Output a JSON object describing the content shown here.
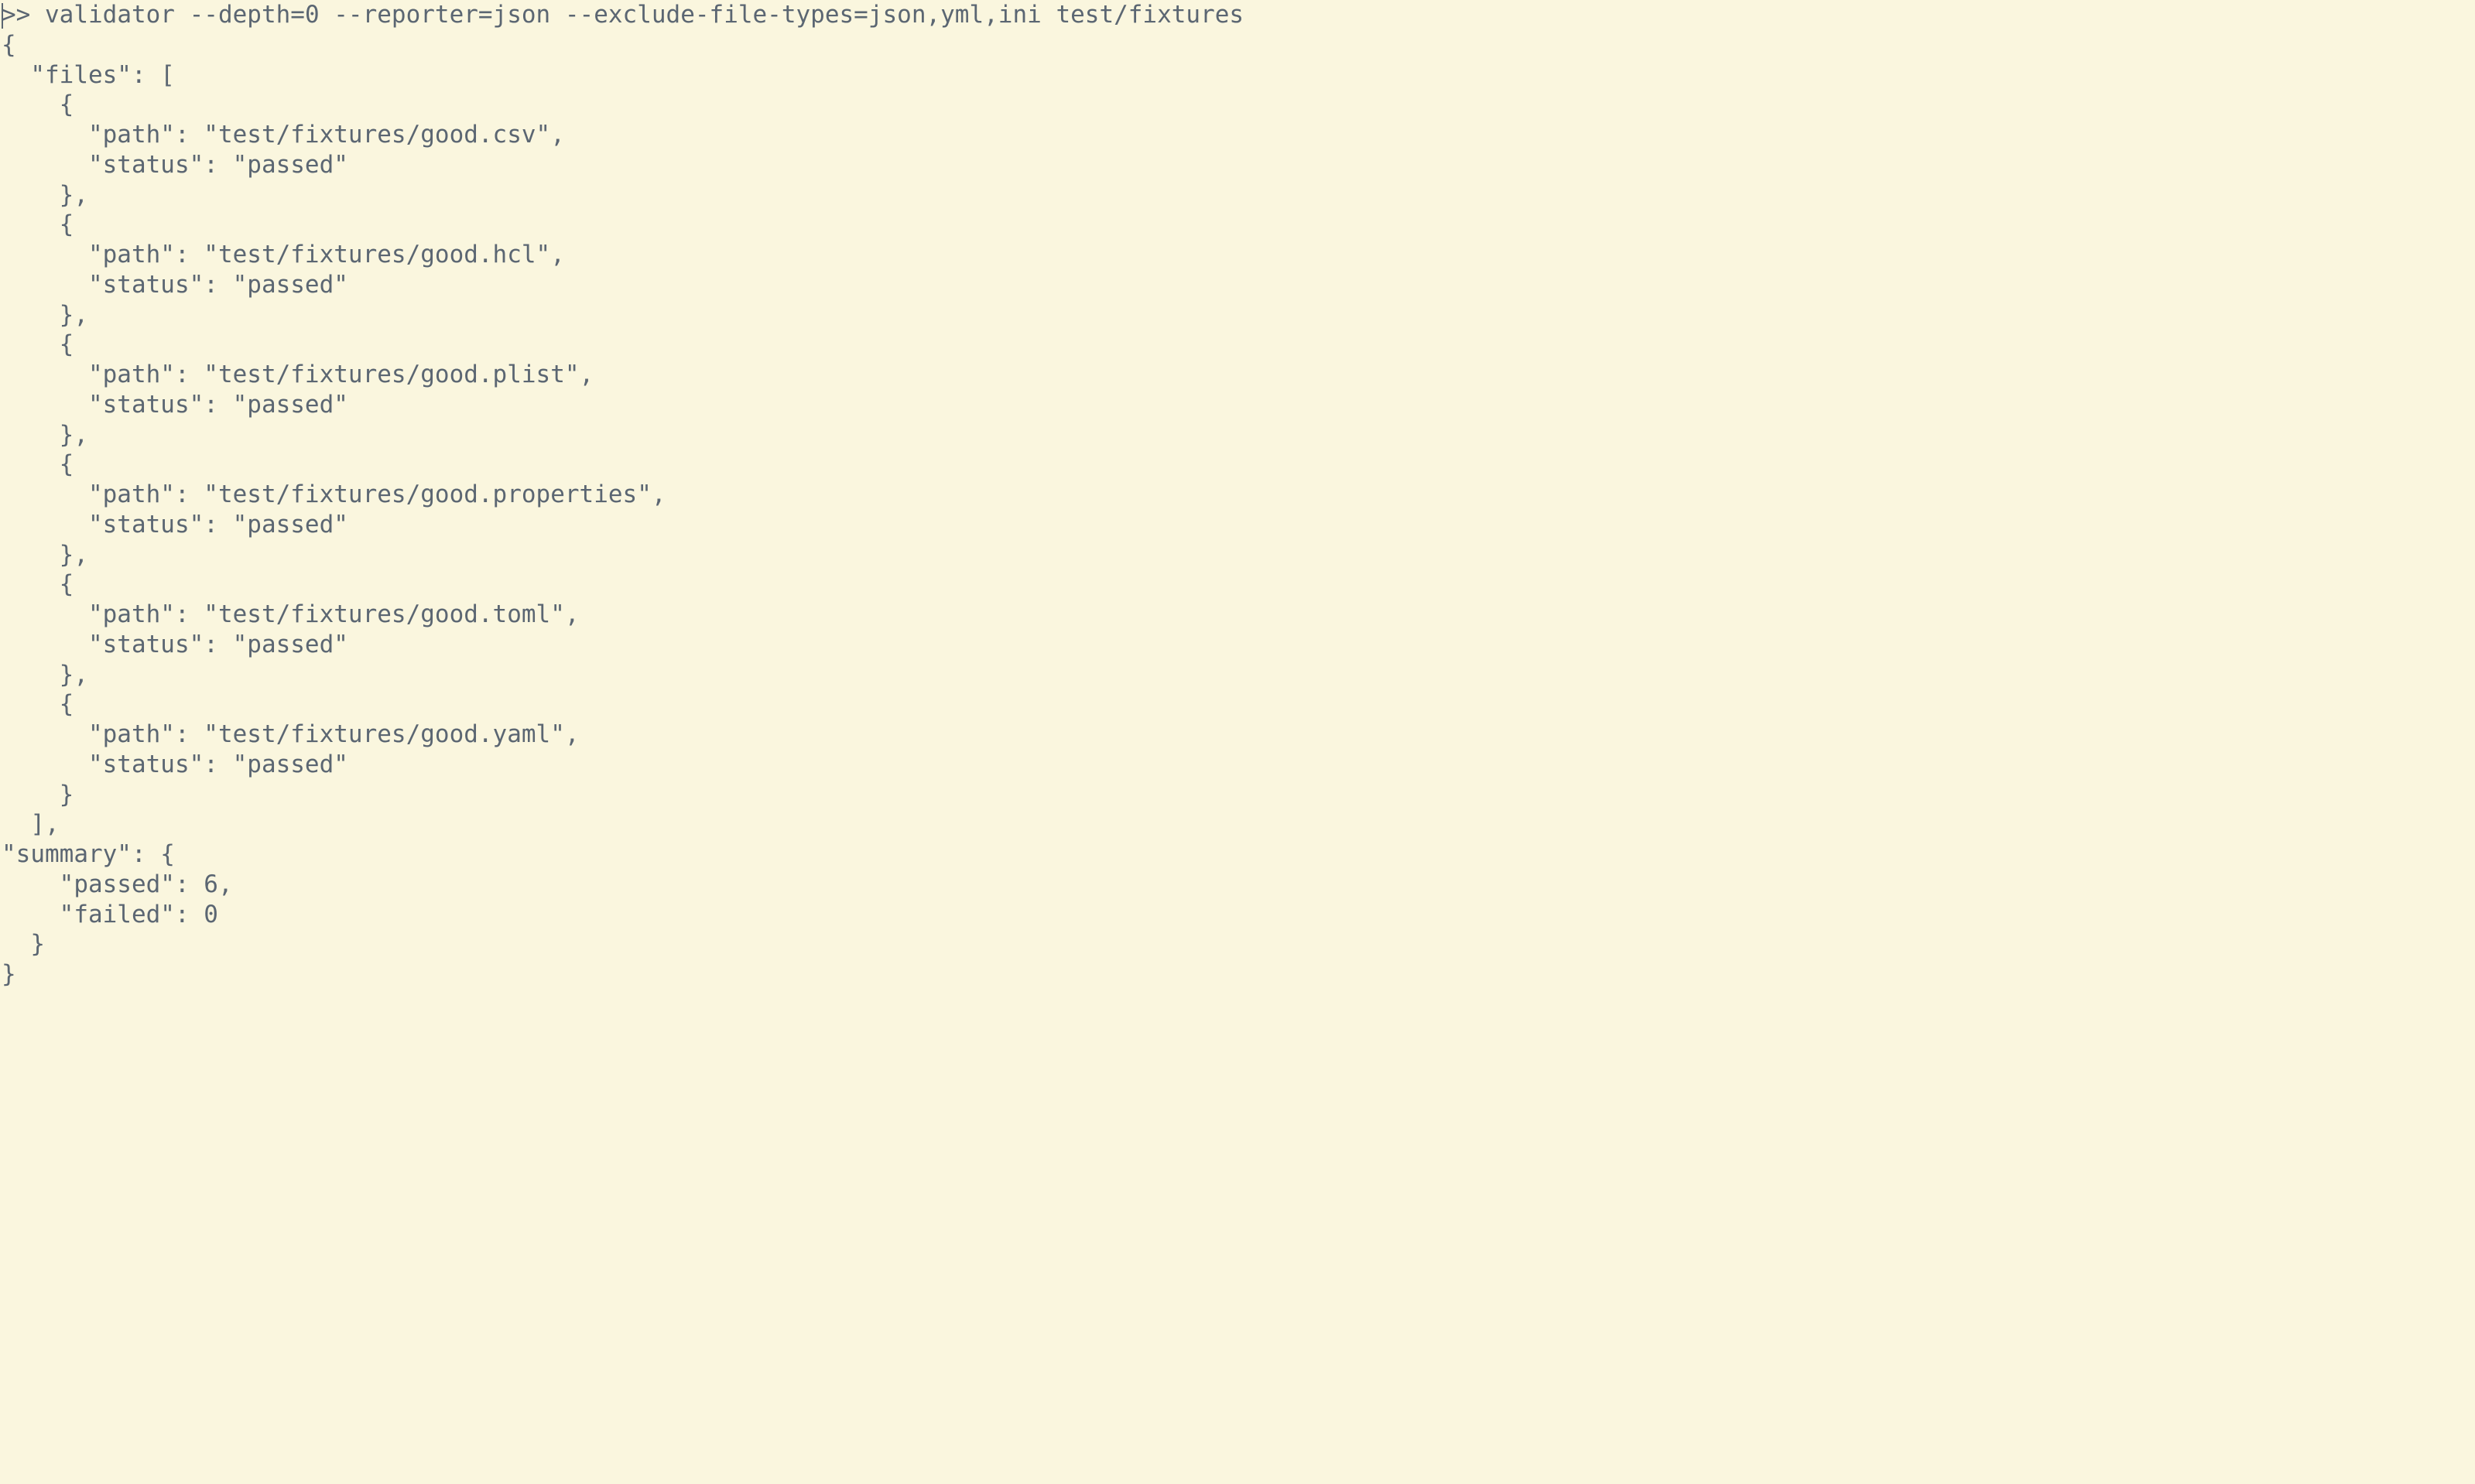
{
  "prompt": ">>",
  "command": "validator --depth=0 --reporter=json --exclude-file-types=json,yml,ini test/fixtures",
  "output": {
    "files": [
      {
        "path": "test/fixtures/good.csv",
        "status": "passed"
      },
      {
        "path": "test/fixtures/good.hcl",
        "status": "passed"
      },
      {
        "path": "test/fixtures/good.plist",
        "status": "passed"
      },
      {
        "path": "test/fixtures/good.properties",
        "status": "passed"
      },
      {
        "path": "test/fixtures/good.toml",
        "status": "passed"
      },
      {
        "path": "test/fixtures/good.yaml",
        "status": "passed"
      }
    ],
    "summary": {
      "passed": 6,
      "failed": 0
    }
  }
}
